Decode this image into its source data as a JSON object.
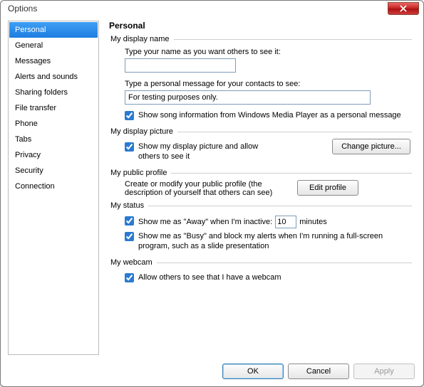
{
  "window": {
    "title": "Options"
  },
  "sidebar": {
    "items": [
      {
        "label": "Personal",
        "selected": true
      },
      {
        "label": "General"
      },
      {
        "label": "Messages"
      },
      {
        "label": "Alerts and sounds"
      },
      {
        "label": "Sharing folders"
      },
      {
        "label": "File transfer"
      },
      {
        "label": "Phone"
      },
      {
        "label": "Tabs"
      },
      {
        "label": "Privacy"
      },
      {
        "label": "Security"
      },
      {
        "label": "Connection"
      }
    ]
  },
  "main": {
    "header": "Personal",
    "display_name": {
      "legend": "My display name",
      "label": "Type your name as you want others to see it:",
      "value": "",
      "message_label": "Type a personal message for your contacts to see:",
      "message_value": "For testing purposes only.",
      "song_checked": true,
      "song_label": "Show song information from Windows Media Player as a personal message"
    },
    "display_picture": {
      "legend": "My display picture",
      "show_checked": true,
      "show_label": "Show my display picture and allow others to see it",
      "change_button": "Change picture..."
    },
    "public_profile": {
      "legend": "My public profile",
      "text": "Create or modify your public profile (the description of yourself that others can see)",
      "edit_button": "Edit profile"
    },
    "status": {
      "legend": "My status",
      "away_checked": true,
      "away_prefix": "Show me as \"Away\" when I'm inactive:",
      "away_value": "10",
      "away_suffix": "minutes",
      "busy_checked": true,
      "busy_label": "Show me as \"Busy\" and block my alerts when I'm running a full-screen program, such as a slide presentation"
    },
    "webcam": {
      "legend": "My webcam",
      "allow_checked": true,
      "allow_label": "Allow others to see that I have a webcam"
    }
  },
  "footer": {
    "ok": "OK",
    "cancel": "Cancel",
    "apply": "Apply"
  }
}
